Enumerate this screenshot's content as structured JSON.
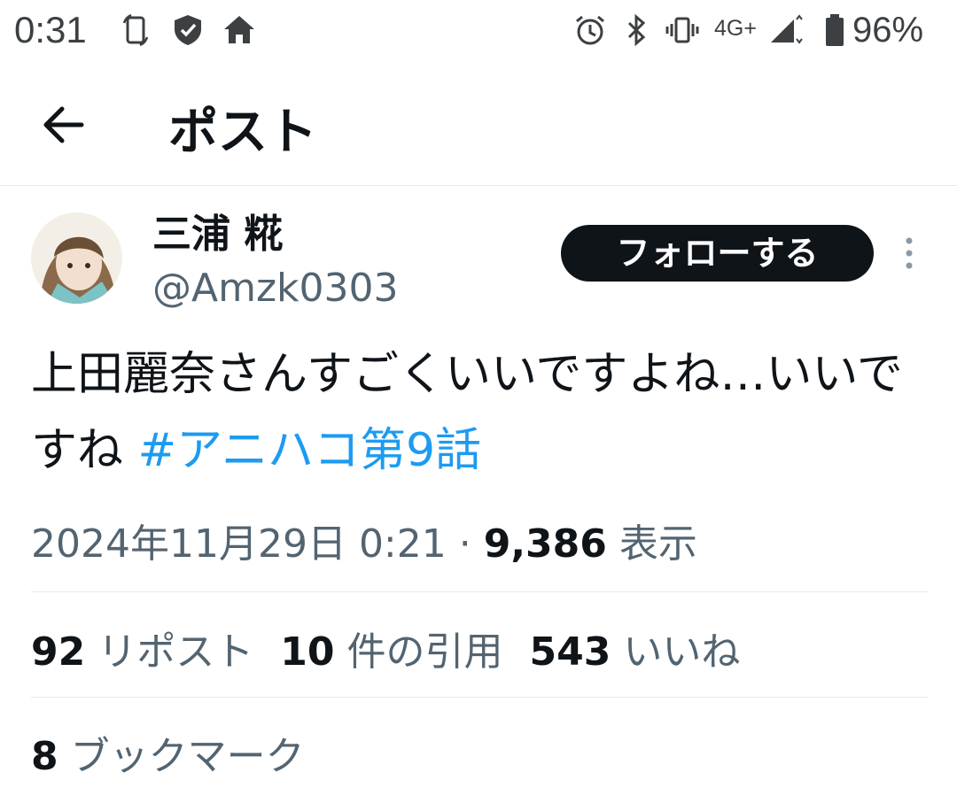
{
  "status_bar": {
    "time": "0:31",
    "network": "4G+",
    "battery": "96%",
    "left_icons": [
      "screen-rotate-icon",
      "shield-icon",
      "home-icon"
    ],
    "right_icons": [
      "alarm-icon",
      "bluetooth-icon",
      "vibrate-icon",
      "signal-icon",
      "battery-icon"
    ]
  },
  "header": {
    "title": "ポスト",
    "back_icon": "back-arrow-icon"
  },
  "author": {
    "display_name": "三浦 糀",
    "handle": "@Amzk0303",
    "follow_label": "フォローする",
    "more_icon": "more-vertical-icon"
  },
  "post": {
    "text": "上田麗奈さんすごくいいですよね…いいですね ",
    "hashtag": "#アニハコ第9話",
    "timestamp": "2024年11月29日 0:21",
    "separator": " · ",
    "views_count": "9,386",
    "views_label": " 表示"
  },
  "stats": {
    "reposts_count": "92",
    "reposts_label": " リポスト",
    "quotes_count": "10",
    "quotes_label": " 件の引用",
    "likes_count": "543",
    "likes_label": " いいね",
    "bookmarks_count": "8",
    "bookmarks_label": " ブックマーク"
  },
  "colors": {
    "text_primary": "#0f1419",
    "text_secondary": "#536471",
    "link": "#1d9bf0",
    "divider": "#e6e9eb",
    "button_bg": "#0f1419"
  }
}
